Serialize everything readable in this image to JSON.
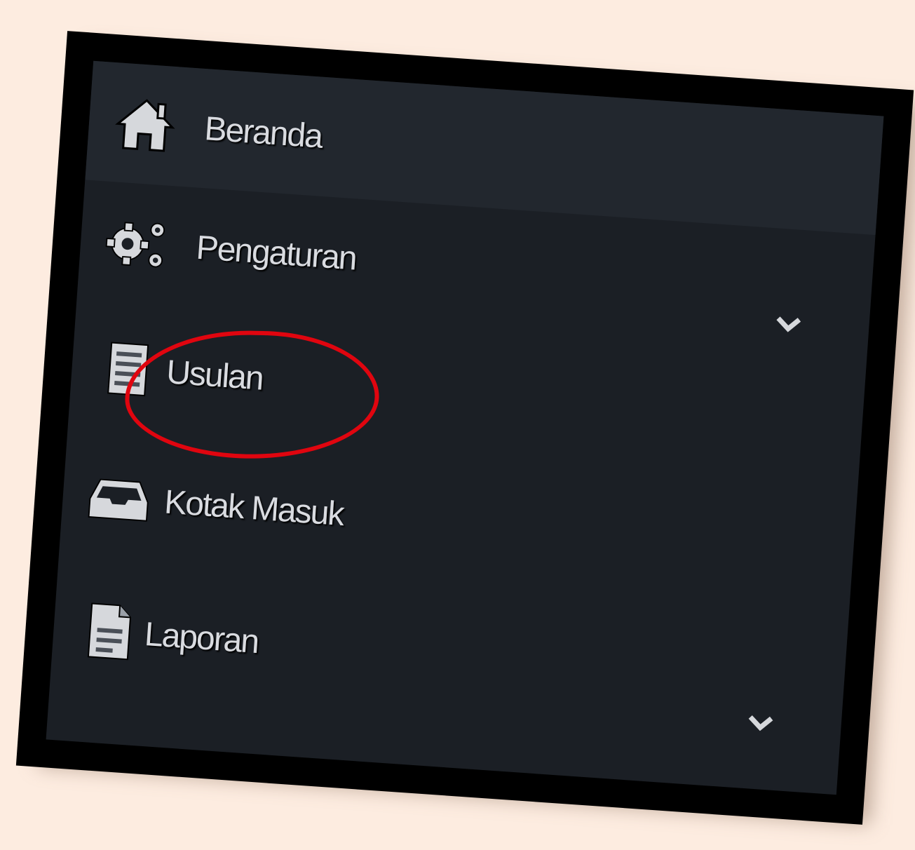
{
  "sidebar": {
    "items": [
      {
        "label": "Beranda",
        "icon": "home-icon",
        "active": true,
        "expandable": false
      },
      {
        "label": "Pengaturan",
        "icon": "gears-icon",
        "active": false,
        "expandable": true
      },
      {
        "label": "Usulan",
        "icon": "list-document-icon",
        "active": false,
        "expandable": false,
        "highlighted": true
      },
      {
        "label": "Kotak Masuk",
        "icon": "inbox-icon",
        "active": false,
        "expandable": false
      },
      {
        "label": "Laporan",
        "icon": "report-file-icon",
        "active": false,
        "expandable": true
      }
    ]
  },
  "colors": {
    "page_background": "#fdece0",
    "frame": "#000000",
    "panel_background": "#1b1f25",
    "active_item_background": "#22272e",
    "text": "#d9dbe0",
    "highlight_ring": "#e0050f"
  }
}
